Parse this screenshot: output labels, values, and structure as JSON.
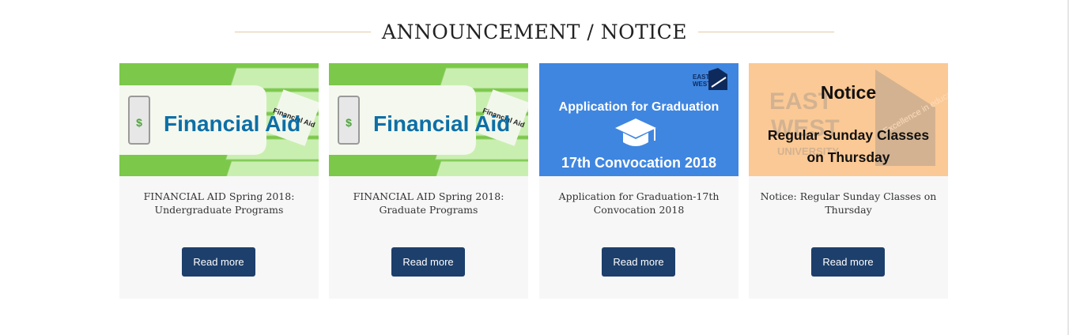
{
  "section": {
    "title": "ANNOUNCEMENT / NOTICE"
  },
  "cards": [
    {
      "thumb": {
        "heading": "Financial Aid",
        "tab_label": "Financial Aid"
      },
      "title": "FINANCIAL AID Spring 2018: Undergraduate Programs",
      "button": "Read more"
    },
    {
      "thumb": {
        "heading": "Financial Aid",
        "tab_label": "Financial Aid"
      },
      "title": "FINANCIAL AID Spring 2018: Graduate Programs",
      "button": "Read more"
    },
    {
      "thumb": {
        "line1": "Application for Graduation",
        "line2": "17th Convocation 2018",
        "logo_line1": "EAST",
        "logo_line2": "WEST"
      },
      "title": "Application for Graduation-17th Convocation 2018",
      "button": "Read more"
    },
    {
      "thumb": {
        "heading": "Notice",
        "line1": "Regular Sunday Classes",
        "line2": "on Thursday",
        "bg_word1": "EAST",
        "bg_word2": "WEST",
        "bg_word3": "UNIVERSITY",
        "bg_motto": "Excellence in education"
      },
      "title": "Notice: Regular Sunday Classes on Thursday",
      "button": "Read more"
    }
  ],
  "colors": {
    "button_bg": "#1d3f6b",
    "card_bg": "#f7f7f7",
    "rule": "#e4c9a0",
    "financial_green": "#7cc84a",
    "graduation_blue": "#3f86e0",
    "notice_peach": "#fbc995"
  }
}
